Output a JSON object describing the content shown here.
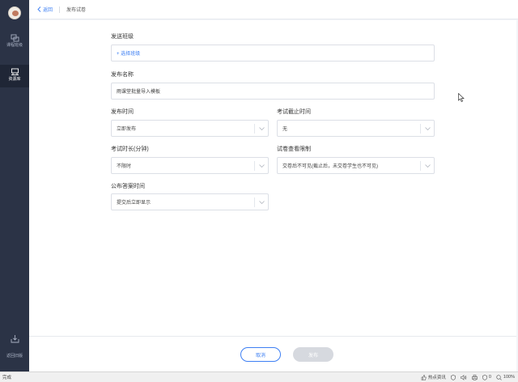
{
  "sidebar": {
    "items": [
      {
        "label": "课程班级",
        "icon": "class-icon"
      },
      {
        "label": "资源库",
        "icon": "library-icon",
        "active": true
      }
    ],
    "back_label": "返回旧版"
  },
  "breadcrumb": {
    "back": "返回",
    "current": "发布试卷"
  },
  "form": {
    "send_class": {
      "label": "发送班级",
      "action": "+ 选择班级"
    },
    "publish_name": {
      "label": "发布名称",
      "value": "雨课堂批量导入模板"
    },
    "publish_time": {
      "label": "发布时间",
      "value": "立即发布"
    },
    "deadline": {
      "label": "考试截止时间",
      "value": "无"
    },
    "duration": {
      "label": "考试时长(分钟)",
      "value": "不限时"
    },
    "view_limit": {
      "label": "试卷查看限制",
      "value": "交卷后不可见(截止后，未交卷学生也不可见)"
    },
    "answer_time": {
      "label": "公布答案时间",
      "value": "提交后立即显示"
    }
  },
  "footer": {
    "cancel": "取消",
    "publish": "发布"
  },
  "statusbar": {
    "left": "完成",
    "items": [
      "热点资讯",
      "",
      "",
      "",
      "0",
      "100%"
    ]
  },
  "colors": {
    "accent": "#3d7ff3",
    "sidebar": "#2b3346",
    "disabled": "#d6d9df"
  }
}
